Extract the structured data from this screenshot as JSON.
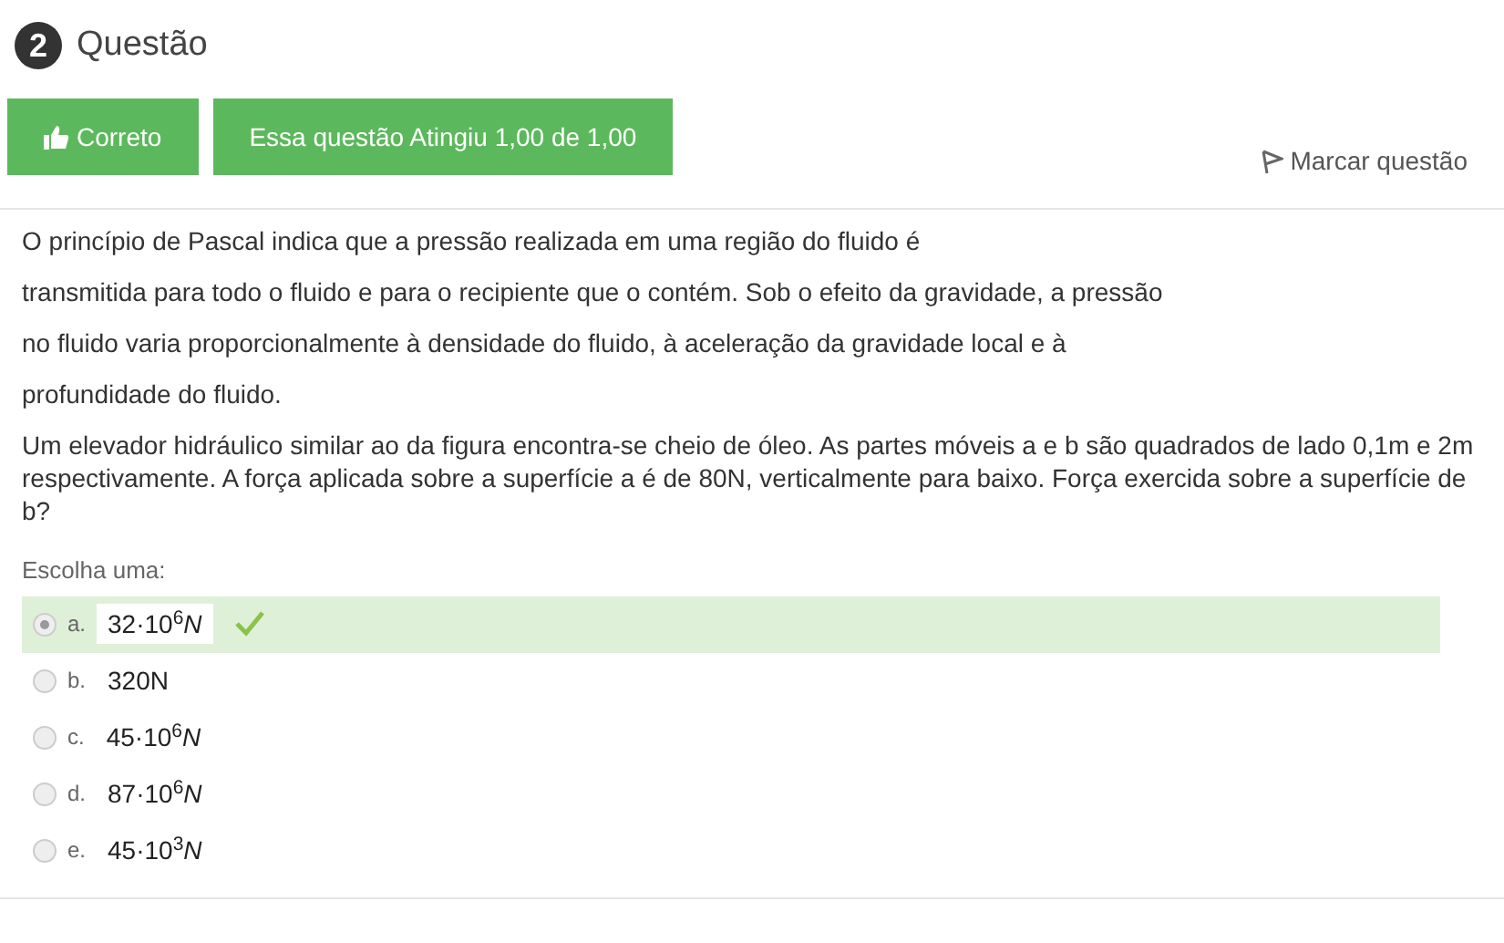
{
  "question": {
    "number": "2",
    "title": "Questão"
  },
  "status": {
    "state_button": "Correto",
    "grade_button": "Essa questão Atingiu 1,00 de 1,00",
    "flag": {
      "label": "Marcar questão",
      "flagged": false
    }
  },
  "text_lines": [
    "O princípio de Pascal indica que a pressão realizada em uma região do fluido é",
    "transmitida para todo o fluido e para o recipiente que o contém. Sob o efeito da gravidade, a pressão",
    "no fluido varia proporcionalmente à densidade do fluido, à aceleração da gravidade local e à",
    "profundidade do fluido.",
    "Um elevador hidráulico similar ao da figura encontra-se cheio de óleo. As partes móveis a e b são quadrados de lado 0,1m e 2m respectivamente. A força aplicada sobre a superfície a é de 80N, verticalmente para baixo. Força exercida sobre a superfície de b?"
  ],
  "prompt": "Escolha uma:",
  "options": [
    {
      "letter": "a.",
      "text": "32·10$^{6}$*N*",
      "selected": true,
      "correct": true
    },
    {
      "letter": "b.",
      "text": "320N",
      "selected": false,
      "correct": false
    },
    {
      "letter": "c.",
      "text": "45·10$^{6}$*N*",
      "selected": false,
      "correct": false
    },
    {
      "letter": "d.",
      "text": "87·10$^{6}$*N*",
      "selected": false,
      "correct": false
    },
    {
      "letter": "e.",
      "text": "45·10$^{3}$*N*",
      "selected": false,
      "correct": false
    }
  ]
}
